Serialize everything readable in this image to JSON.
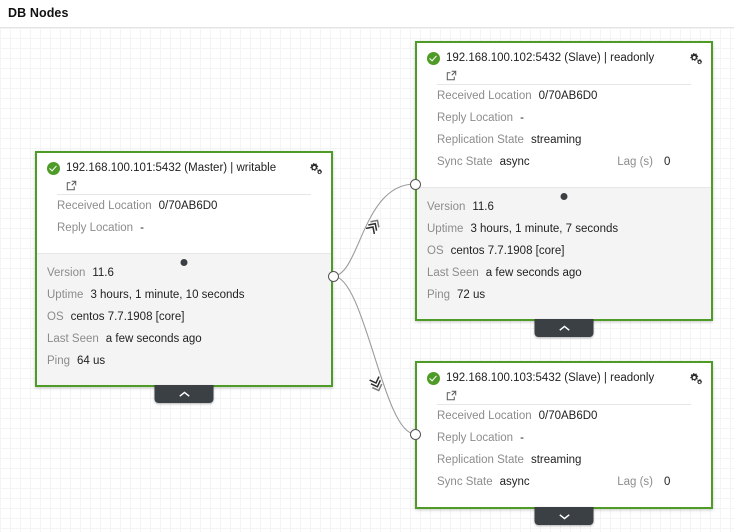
{
  "page": {
    "title": "DB Nodes"
  },
  "theme": {
    "node_border": "#4f9b28",
    "status_ok": "#4f9b28",
    "label_color": "#8c8c8c",
    "value_color": "#1f1f1f",
    "tab_color": "#3b4045",
    "body_bg": "#f4f4f4"
  },
  "icons": {
    "status_ok": "check-circle-icon",
    "settings": "cogs-icon",
    "external_link": "external-link-icon",
    "collapse": "chevron-up-icon",
    "expand": "chevron-down-icon"
  },
  "nodes": [
    {
      "id": "master",
      "title": "192.168.100.101:5432 (Master) | writable",
      "status": "ok",
      "expanded": true,
      "toggle_icon": "chevron-up-icon",
      "head_props": [
        {
          "label": "Received Location",
          "value": "0/70AB6D0"
        },
        {
          "label": "Reply Location",
          "value": "-"
        }
      ],
      "body_props": [
        {
          "label": "Version",
          "value": "11.6"
        },
        {
          "label": "Uptime",
          "value": "3 hours, 1 minute, 10 seconds"
        },
        {
          "label": "OS",
          "value": "centos 7.7.1908 [core]"
        },
        {
          "label": "Last Seen",
          "value": "a few seconds ago"
        },
        {
          "label": "Ping",
          "value": "64 us"
        }
      ]
    },
    {
      "id": "slave-102",
      "title": "192.168.100.102:5432 (Slave) | readonly",
      "status": "ok",
      "expanded": true,
      "toggle_icon": "chevron-up-icon",
      "head_props": [
        {
          "label": "Received Location",
          "value": "0/70AB6D0"
        },
        {
          "label": "Reply Location",
          "value": "-"
        },
        {
          "label": "Replication State",
          "value": "streaming"
        },
        {
          "label": "Sync State",
          "value": "async",
          "label2": "Lag (s)",
          "value2": "0"
        }
      ],
      "body_props": [
        {
          "label": "Version",
          "value": "11.6"
        },
        {
          "label": "Uptime",
          "value": "3 hours, 1 minute, 7 seconds"
        },
        {
          "label": "OS",
          "value": "centos 7.7.1908 [core]"
        },
        {
          "label": "Last Seen",
          "value": "a few seconds ago"
        },
        {
          "label": "Ping",
          "value": "72 us"
        }
      ]
    },
    {
      "id": "slave-103",
      "title": "192.168.100.103:5432 (Slave) | readonly",
      "status": "ok",
      "expanded": false,
      "toggle_icon": "chevron-down-icon",
      "head_props": [
        {
          "label": "Received Location",
          "value": "0/70AB6D0"
        },
        {
          "label": "Reply Location",
          "value": "-"
        },
        {
          "label": "Replication State",
          "value": "streaming"
        },
        {
          "label": "Sync State",
          "value": "async",
          "label2": "Lag (s)",
          "value2": "0"
        }
      ],
      "body_props": []
    }
  ],
  "edges": [
    {
      "from": "master",
      "to": "slave-102"
    },
    {
      "from": "master",
      "to": "slave-103"
    }
  ]
}
